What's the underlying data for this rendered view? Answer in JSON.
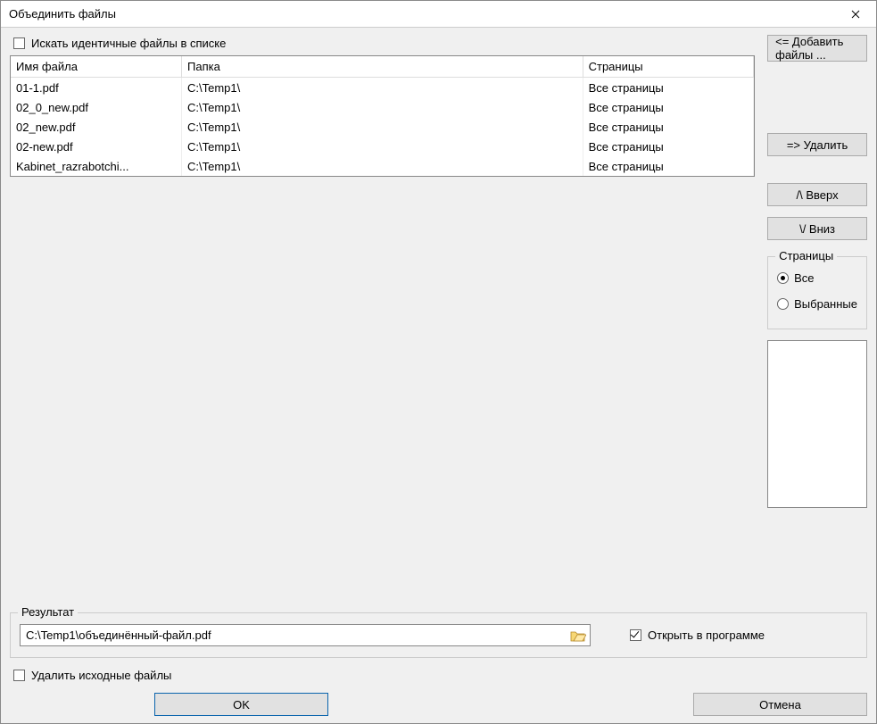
{
  "window": {
    "title": "Объединить файлы"
  },
  "options": {
    "search_identical_label": "Искать идентичные файлы в списке",
    "search_identical_checked": false,
    "delete_source_label": "Удалить исходные файлы",
    "delete_source_checked": false,
    "open_in_program_label": "Открыть в программе",
    "open_in_program_checked": true
  },
  "table": {
    "headers": {
      "name": "Имя файла",
      "folder": "Папка",
      "pages": "Страницы"
    },
    "rows": [
      {
        "name": "01-1.pdf",
        "folder": "C:\\Temp1\\",
        "pages": "Все страницы"
      },
      {
        "name": "02_0_new.pdf",
        "folder": "C:\\Temp1\\",
        "pages": "Все страницы"
      },
      {
        "name": "02_new.pdf",
        "folder": "C:\\Temp1\\",
        "pages": "Все страницы"
      },
      {
        "name": "02-new.pdf",
        "folder": "C:\\Temp1\\",
        "pages": "Все страницы"
      },
      {
        "name": "Kabinet_razrabotchi...",
        "folder": "C:\\Temp1\\",
        "pages": "Все страницы"
      }
    ]
  },
  "buttons": {
    "add_files": "<= Добавить файлы ...",
    "remove": "=>  Удалить",
    "up": "/\\   Вверх",
    "down": "\\/   Вниз",
    "ok": "OK",
    "cancel": "Отмена"
  },
  "pages_group": {
    "legend": "Страницы",
    "all": "Все",
    "selected": "Выбранные",
    "choice": "all"
  },
  "result": {
    "legend": "Результат",
    "path": "C:\\Temp1\\объединённый-файл.pdf"
  }
}
